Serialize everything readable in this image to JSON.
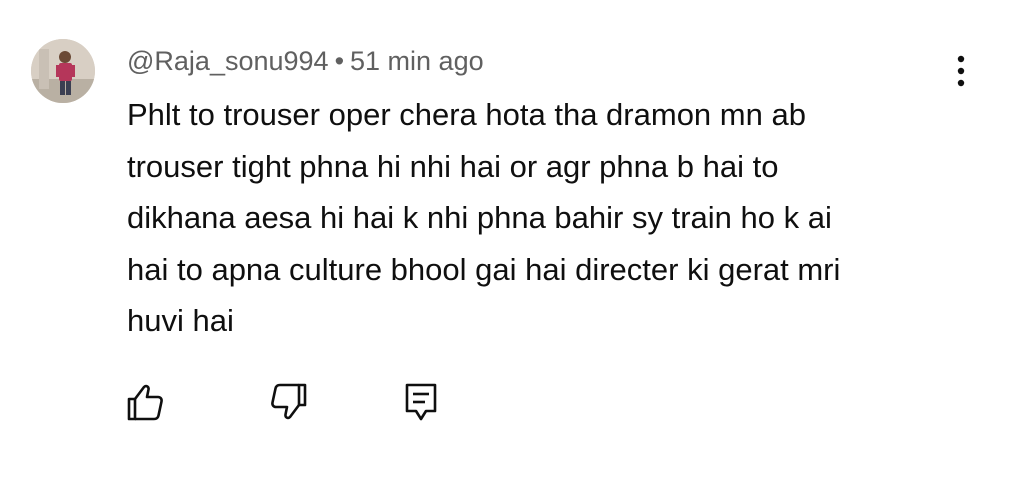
{
  "comment": {
    "author": "@Raja_sonu994",
    "separator": "•",
    "time": "51 min ago",
    "text": "Phlt to trouser oper chera hota tha dramon mn ab\ntrouser tight phna hi nhi hai or agr phna b hai to\ndikhana aesa hi hai k nhi phna bahir sy train ho k ai\nhai to apna culture bhool gai hai directer ki gerat mri\nhuvi hai"
  },
  "icons": {
    "avatar": "avatar",
    "more": "more-vert-icon",
    "like": "thumbs-up-icon",
    "dislike": "thumbs-down-icon",
    "reply": "reply-comment-icon"
  },
  "colors": {
    "text": "#0f0f0f",
    "meta": "#606060",
    "icon": "#0f0f0f"
  }
}
